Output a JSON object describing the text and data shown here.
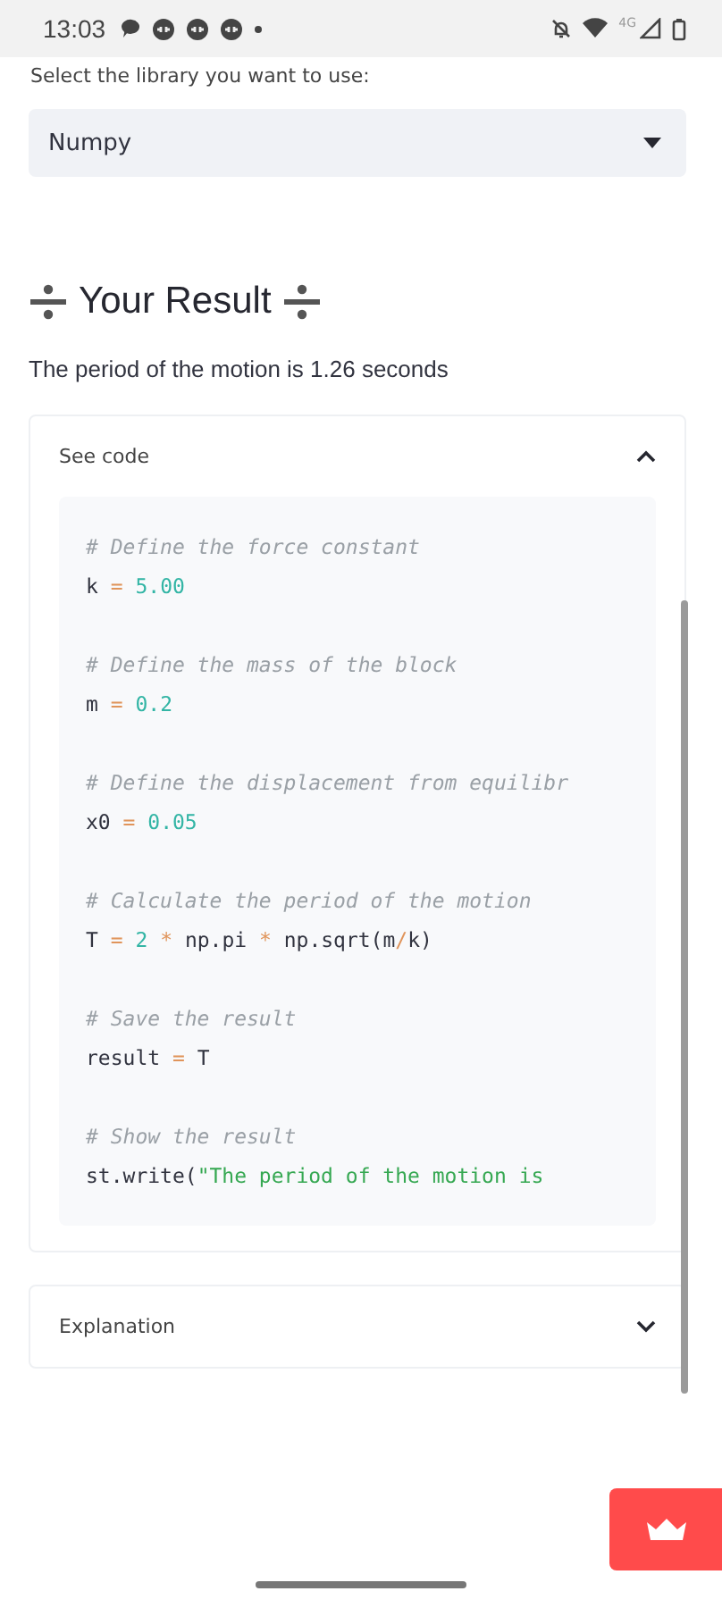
{
  "status_bar": {
    "time": "13:03",
    "network": "4G"
  },
  "library_select": {
    "label": "Select the library you want to use:",
    "value": "Numpy"
  },
  "result": {
    "title": "Your Result",
    "text": "The period of the motion is 1.26 seconds"
  },
  "expanders": [
    {
      "title": "See code",
      "expanded": true,
      "code": [
        [
          [
            {
              "kind": "comment",
              "text": "# Define the force constant"
            }
          ],
          [
            {
              "kind": "plain",
              "text": "k "
            },
            {
              "kind": "op",
              "text": "="
            },
            {
              "kind": "num",
              "text": " 5.00"
            }
          ]
        ],
        [
          [
            {
              "kind": "comment",
              "text": "# Define the mass of the block"
            }
          ],
          [
            {
              "kind": "plain",
              "text": "m "
            },
            {
              "kind": "op",
              "text": "="
            },
            {
              "kind": "num",
              "text": " 0.2"
            }
          ]
        ],
        [
          [
            {
              "kind": "comment",
              "text": "# Define the displacement from equilibr"
            }
          ],
          [
            {
              "kind": "plain",
              "text": "x0 "
            },
            {
              "kind": "op",
              "text": "="
            },
            {
              "kind": "num",
              "text": " 0.05"
            }
          ]
        ],
        [
          [
            {
              "kind": "comment",
              "text": "# Calculate the period of the motion"
            }
          ],
          [
            {
              "kind": "plain",
              "text": "T "
            },
            {
              "kind": "op",
              "text": "="
            },
            {
              "kind": "num",
              "text": " 2 "
            },
            {
              "kind": "op",
              "text": "*"
            },
            {
              "kind": "plain",
              "text": " np.pi "
            },
            {
              "kind": "op",
              "text": "*"
            },
            {
              "kind": "plain",
              "text": " np.sqrt(m"
            },
            {
              "kind": "op",
              "text": "/"
            },
            {
              "kind": "plain",
              "text": "k)"
            }
          ]
        ],
        [
          [
            {
              "kind": "comment",
              "text": "# Save the result"
            }
          ],
          [
            {
              "kind": "plain",
              "text": "result "
            },
            {
              "kind": "op",
              "text": "="
            },
            {
              "kind": "plain",
              "text": " T"
            }
          ]
        ],
        [
          [
            {
              "kind": "comment",
              "text": "# Show the result"
            }
          ],
          [
            {
              "kind": "plain",
              "text": "st.write("
            },
            {
              "kind": "str",
              "text": "\"The period of the motion is"
            }
          ]
        ]
      ]
    },
    {
      "title": "Explanation",
      "expanded": false
    }
  ]
}
